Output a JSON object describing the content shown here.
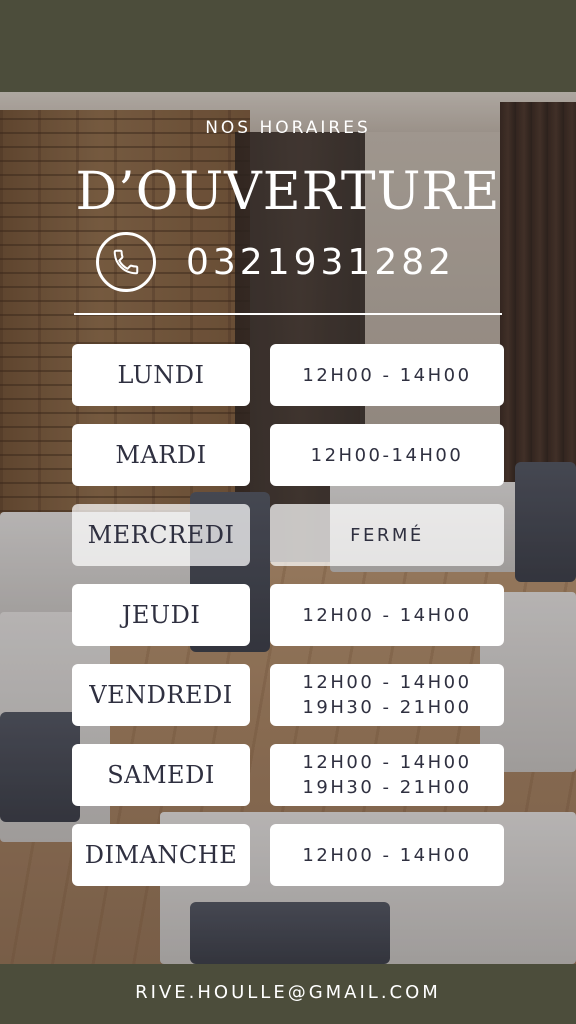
{
  "header": {
    "eyebrow": "NOS HORAIRES",
    "title": "D’OUVERTURE",
    "phone": "0321931282"
  },
  "schedule": [
    {
      "day": "LUNDI",
      "hours": [
        "12H00 - 14H00"
      ]
    },
    {
      "day": "MARDI",
      "hours": [
        "12H00-14H00"
      ]
    },
    {
      "day": "MERCREDI",
      "hours": [
        "FERMÉ"
      ]
    },
    {
      "day": "JEUDI",
      "hours": [
        "12H00 - 14H00"
      ]
    },
    {
      "day": "VENDREDI",
      "hours": [
        "12H00 - 14H00",
        "19H30 - 21H00"
      ]
    },
    {
      "day": "SAMEDI",
      "hours": [
        "12H00 - 14H00",
        "19H30 - 21H00"
      ]
    },
    {
      "day": "DIMANCHE",
      "hours": [
        "12H00 - 14H00"
      ]
    }
  ],
  "footer": {
    "email": "RIVE.HOULLE@GMAIL.COM"
  },
  "icons": {
    "phone": "phone-icon"
  },
  "colors": {
    "band": "#4c4d3b",
    "box": "#ffffff",
    "box_text": "#2f3040"
  }
}
